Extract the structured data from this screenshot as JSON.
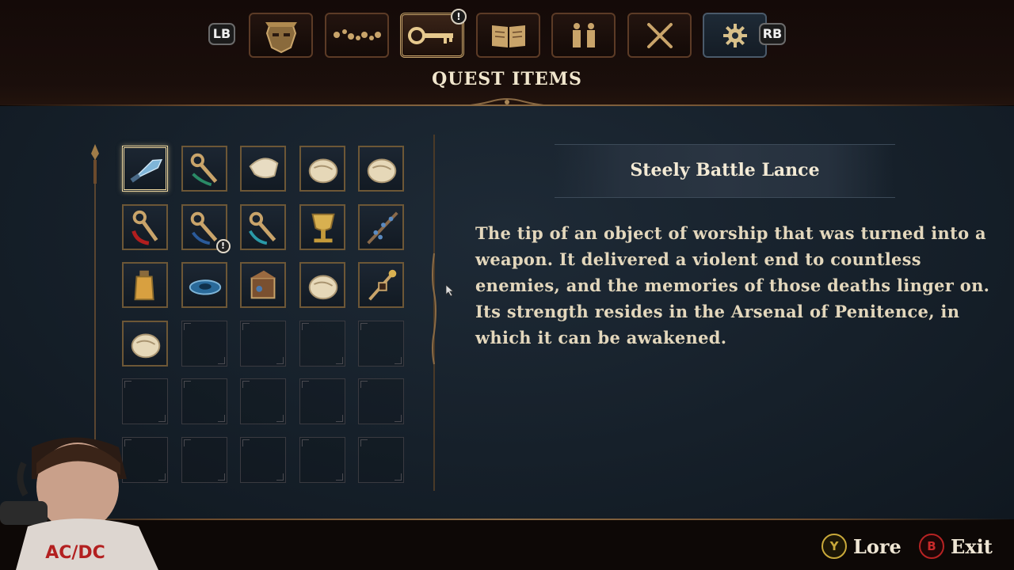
{
  "top_nav": {
    "left_bumper": "LB",
    "right_bumper": "RB",
    "tabs": [
      {
        "icon": "character-mask-icon"
      },
      {
        "icon": "rosary-beads-icon"
      },
      {
        "icon": "key-icon",
        "badge": "!"
      },
      {
        "icon": "book-icon"
      },
      {
        "icon": "figures-icon"
      },
      {
        "icon": "crossed-swords-icon"
      },
      {
        "icon": "gear-icon"
      }
    ],
    "active_tab_index": 2
  },
  "page": {
    "title": "QUEST ITEMS"
  },
  "inventory": {
    "columns": 5,
    "rows": 6,
    "items": [
      {
        "icon": "steely-lance-icon",
        "selected": true
      },
      {
        "icon": "green-key-icon"
      },
      {
        "icon": "cloth-relic-icon"
      },
      {
        "icon": "skull-relic-icon"
      },
      {
        "icon": "skull-relic-icon"
      },
      {
        "icon": "red-key-icon"
      },
      {
        "icon": "blue-key-icon",
        "badge": "!"
      },
      {
        "icon": "teal-key-icon"
      },
      {
        "icon": "golden-chalice-icon"
      },
      {
        "icon": "branch-icon"
      },
      {
        "icon": "vial-icon"
      },
      {
        "icon": "blue-disc-icon"
      },
      {
        "icon": "reliquary-box-icon"
      },
      {
        "icon": "skull-relic-icon"
      },
      {
        "icon": "incense-icon"
      },
      {
        "icon": "skull-relic-icon"
      }
    ]
  },
  "detail": {
    "title": "Steely Battle Lance",
    "description": "The tip of an object of worship that was turned into a weapon. It delivered a violent end to countless enemies, and the memories of those deaths linger on. Its strength resides in the Arsenal of Penitence, in which it can be awakened."
  },
  "footer": {
    "lore": {
      "button": "Y",
      "label": "Lore"
    },
    "exit": {
      "button": "B",
      "label": "Exit"
    }
  },
  "webcam": {
    "shirt_text": "AC/DC"
  },
  "colors": {
    "gold": "#c9a46a",
    "panel": "#16202a",
    "text": "#e3d7bc",
    "y_button": "#c9a93a",
    "b_button": "#b72323"
  }
}
